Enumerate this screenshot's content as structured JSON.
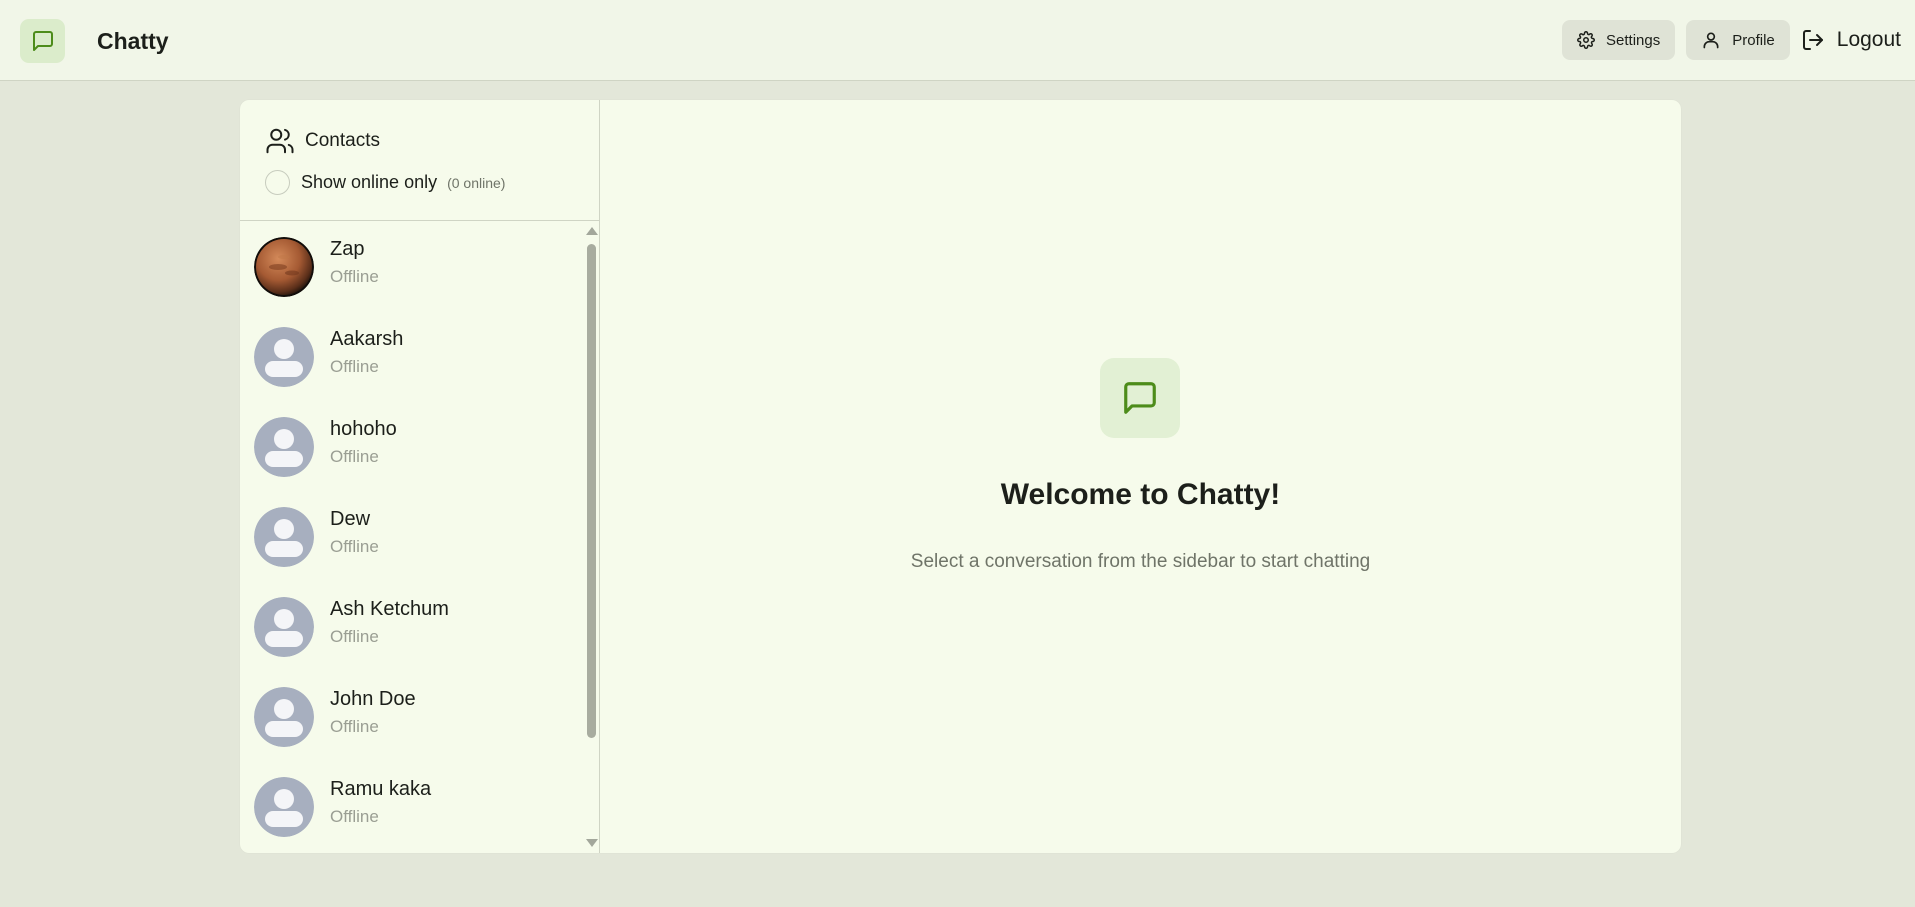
{
  "app": {
    "name": "Chatty",
    "accent": "#4d8c1a",
    "logo_icon": "message-square-icon"
  },
  "nav": {
    "settings_label": "Settings",
    "profile_label": "Profile",
    "logout_label": "Logout"
  },
  "sidebar": {
    "title": "Contacts",
    "filter_label": "Show online only",
    "online_count": "(0 online)",
    "contacts": [
      {
        "name": "Zap",
        "status": "Offline",
        "avatar": "photo"
      },
      {
        "name": "Aakarsh",
        "status": "Offline",
        "avatar": "default"
      },
      {
        "name": "hohoho",
        "status": "Offline",
        "avatar": "default"
      },
      {
        "name": "Dew",
        "status": "Offline",
        "avatar": "default"
      },
      {
        "name": "Ash Ketchum",
        "status": "Offline",
        "avatar": "default"
      },
      {
        "name": "John Doe",
        "status": "Offline",
        "avatar": "default"
      },
      {
        "name": "Ramu kaka",
        "status": "Offline",
        "avatar": "default"
      }
    ]
  },
  "main": {
    "welcome_title": "Welcome to Chatty!",
    "welcome_subtitle": "Select a conversation from the sidebar to start chatting"
  }
}
